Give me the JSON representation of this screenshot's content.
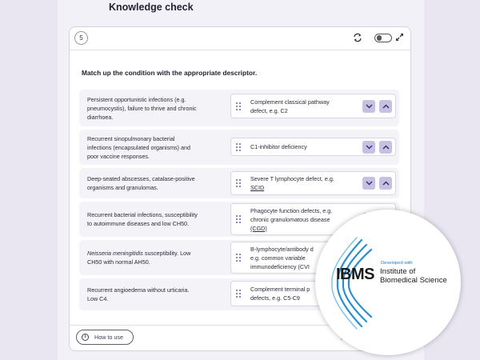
{
  "page": {
    "title": "Knowledge check"
  },
  "card": {
    "question_number": "5",
    "instruction": "Match up the condition with the appropriate descriptor.",
    "icons": {
      "refresh": "refresh-icon",
      "toggle": "toggle-switch",
      "expand": "expand-icon"
    }
  },
  "rows": [
    {
      "condition": [
        "Persistent opportunistic infections (e.g.",
        "pneumocystis), failure to thrive and chronic",
        "diarrhoea."
      ],
      "descriptor": [
        "Complement classical pathway",
        "defect, e.g. C2"
      ]
    },
    {
      "condition": [
        "Recurrent sinopulmonary bacterial",
        "infections (encapsulated organisms) and",
        "poor vaccine responses."
      ],
      "descriptor": [
        "C1-inhibitor deficiency"
      ]
    },
    {
      "condition": [
        "Deep-seated abscesses, catalase-positive",
        "organisms and granulomas."
      ],
      "descriptor": [
        "Severe T lymphocyte defect, e.g.",
        "SCID"
      ]
    },
    {
      "condition": [
        "Recurrent bacterial infections, susceptibility",
        "to autoimmune diseases and low CH50."
      ],
      "descriptor": [
        "Phagocyte function defects, e.g.",
        "chronic granulomatous disease",
        "(CGD)"
      ]
    },
    {
      "condition_italic": "Neisseria meningitidis",
      "condition": [
        " susceptibility. Low",
        "CH50 with normal AH50."
      ],
      "descriptor": [
        "B-lymphocyte/antibody d",
        "e.g. common variable",
        "immunodeficiency (CVI"
      ]
    },
    {
      "condition": [
        "Recurrent angioedema without urticaria.",
        "Low C4."
      ],
      "descriptor": [
        "Complement terminal p",
        "defects, e.g. C5-C9"
      ]
    }
  ],
  "footer": {
    "how_to_use": "How to use",
    "reset": "Rese"
  },
  "badge": {
    "logo_text": "IBMS",
    "developed_with": "Developed with",
    "org_name": [
      "Institute of",
      "Biomedical Science"
    ]
  },
  "colors": {
    "accent": "#c6c0e3",
    "background": "#e9e6f2",
    "row_bg": "#f4f3f7"
  }
}
